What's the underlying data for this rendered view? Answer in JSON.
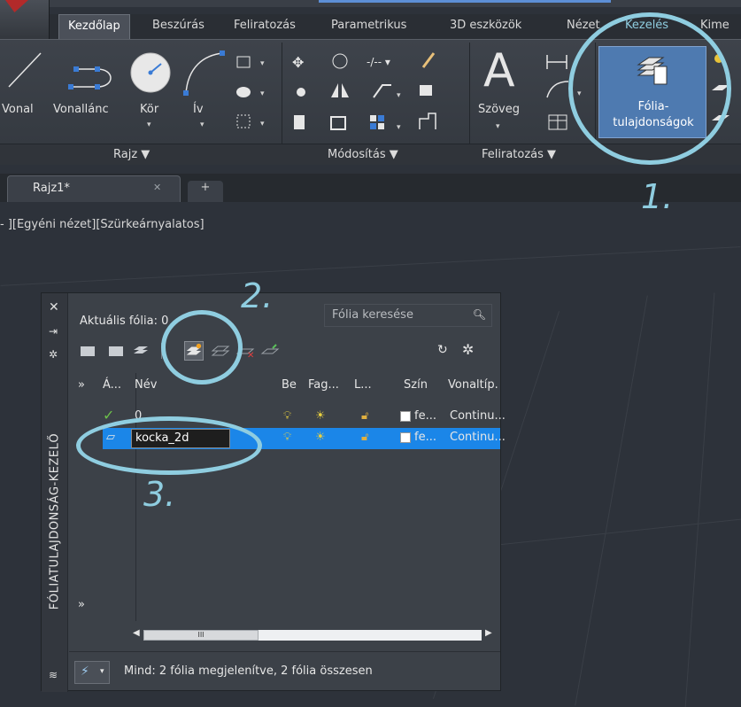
{
  "ribbon": {
    "tabs": [
      "Kezdőlap",
      "Beszúrás",
      "Feliratozás",
      "Parametrikus",
      "3D eszközök",
      "Nézet",
      "Kezelés",
      "Kime"
    ],
    "tools": {
      "line": "Vonal",
      "polyline": "Vonallánc",
      "circle": "Kör",
      "arc": "Ív",
      "text": "Szöveg",
      "layer_properties_line1": "Fólia-",
      "layer_properties_line2": "tulajdonságok"
    },
    "panels": {
      "draw": "Rajz ▼",
      "modify": "Módosítás ▼",
      "annotation": "Feliratozás ▼"
    }
  },
  "document": {
    "tab_title": "Rajz1*",
    "close_glyph": "✕",
    "new_tab_glyph": "+",
    "view_label": "- ][Egyéni nézet][Szürkeárnyalatos]"
  },
  "palette": {
    "vertical_title": "FÓLIATULAJDONSÁG-KEZELŐ",
    "current_layer_label": "Aktuális fólia: 0",
    "search_placeholder": "Fólia keresése",
    "columns": [
      "Á...",
      "Név",
      "Be",
      "Fag...",
      "L...",
      "Szín",
      "Vonaltíp."
    ],
    "tree_expand": "»",
    "layers": [
      {
        "status": "✓",
        "name": "0",
        "color": "fe...",
        "linetype": "Continu..."
      },
      {
        "status": "▱",
        "name": "kocka_2d",
        "color": "fe...",
        "linetype": "Continu..."
      }
    ],
    "status_text": "Mind: 2 fólia megjelenítve, 2 fólia összesen",
    "scroll_thumb": "III"
  },
  "annotations": [
    "1.",
    "2.",
    "3."
  ],
  "colors": {
    "annotation": "#8fcde0",
    "selection": "#1b86e8",
    "ribbon_button_active": "#4e7ab0"
  }
}
